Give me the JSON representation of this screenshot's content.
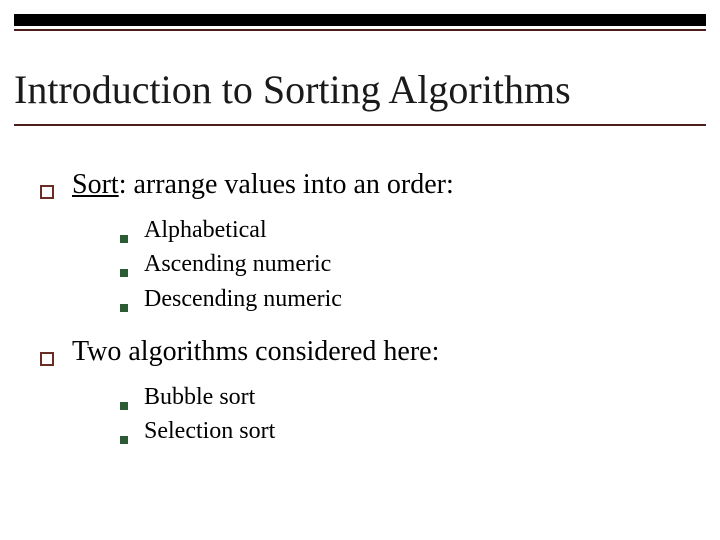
{
  "title": "Introduction to Sorting Algorithms",
  "items": [
    {
      "term": "Sort",
      "rest": ": arrange values into an order:",
      "sub": [
        "Alphabetical",
        "Ascending numeric",
        "Descending numeric"
      ]
    },
    {
      "term": "",
      "rest": "Two algorithms considered here:",
      "sub": [
        "Bubble sort",
        "Selection sort"
      ]
    }
  ]
}
